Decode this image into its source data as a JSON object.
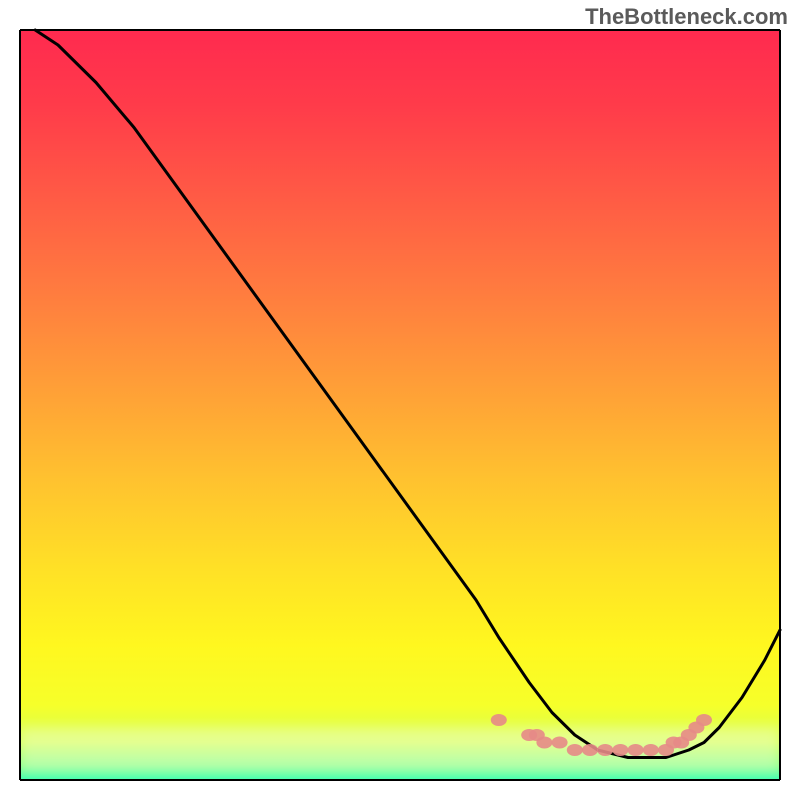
{
  "watermark": "TheBottleneck.com",
  "chart_data": {
    "type": "line",
    "title": "",
    "xlabel": "",
    "ylabel": "",
    "xlim": [
      0,
      100
    ],
    "ylim": [
      0,
      100
    ],
    "grid": false,
    "series": [
      {
        "name": "curve",
        "x": [
          2,
          5,
          10,
          15,
          20,
          25,
          30,
          35,
          40,
          45,
          50,
          55,
          60,
          63,
          65,
          67,
          70,
          73,
          76,
          80,
          83,
          85,
          88,
          90,
          92,
          95,
          98,
          100
        ],
        "y": [
          100,
          98,
          93,
          87,
          80,
          73,
          66,
          59,
          52,
          45,
          38,
          31,
          24,
          19,
          16,
          13,
          9,
          6,
          4,
          3,
          3,
          3,
          4,
          5,
          7,
          11,
          16,
          20
        ]
      },
      {
        "name": "bottleneck-markers",
        "x": [
          63,
          67,
          68,
          69,
          71,
          73,
          75,
          77,
          79,
          81,
          83,
          85,
          86,
          87,
          88,
          89,
          90
        ],
        "y": [
          8,
          6,
          6,
          5,
          5,
          4,
          4,
          4,
          4,
          4,
          4,
          4,
          5,
          5,
          6,
          7,
          8
        ]
      }
    ],
    "gradient_stops": [
      {
        "offset": 0.0,
        "color": "#ff2a4f"
      },
      {
        "offset": 0.1,
        "color": "#ff3b4a"
      },
      {
        "offset": 0.22,
        "color": "#ff5a45"
      },
      {
        "offset": 0.35,
        "color": "#ff7c3f"
      },
      {
        "offset": 0.48,
        "color": "#ffa037"
      },
      {
        "offset": 0.6,
        "color": "#ffc22f"
      },
      {
        "offset": 0.72,
        "color": "#ffe126"
      },
      {
        "offset": 0.82,
        "color": "#fff71f"
      },
      {
        "offset": 0.9,
        "color": "#f6ff2a"
      },
      {
        "offset": 0.95,
        "color": "#d4ff55"
      },
      {
        "offset": 0.98,
        "color": "#8bff7e"
      },
      {
        "offset": 1.0,
        "color": "#3cffb0"
      }
    ],
    "blur_band": {
      "y_center": 4,
      "height": 6
    },
    "marker_color": "#e58a87",
    "curve_color": "#000000",
    "axis_color": "#000000"
  }
}
